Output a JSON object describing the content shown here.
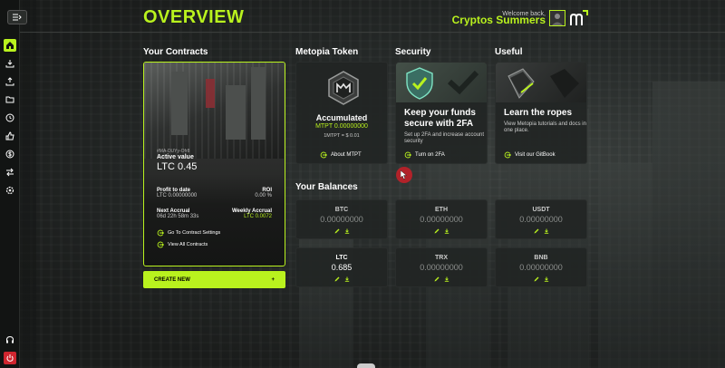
{
  "header": {
    "title": "OVERVIEW",
    "welcome": "Welcome back,",
    "username": "Cryptos Summers"
  },
  "sections": {
    "contracts": "Your Contracts",
    "token": "Metopia Token",
    "security": "Security",
    "useful": "Useful",
    "balances": "Your Balances"
  },
  "contract": {
    "id": "#MA-DUYy-Ofr8",
    "active_label": "Active value",
    "active_value": "LTC 0.45",
    "profit_label": "Profit to date",
    "profit_value": "LTC 0.00000000",
    "roi_label": "ROI",
    "roi_value": "0.00 %",
    "next_label": "Next Accrual",
    "next_value": "06d 22h 58m 33s",
    "weekly_label": "Weekly Accrual",
    "weekly_value": "LTC 0.0072",
    "link_settings": "Go To Contract Settings",
    "link_all": "View All Contracts"
  },
  "create_button": {
    "label": "CREATE NEW",
    "icon": "+"
  },
  "token": {
    "label": "Accumulated",
    "amount": "MTPT 0.00000000",
    "rate": "1MTPT = $ 0.01",
    "link": "About MTPT"
  },
  "security": {
    "title": "Keep your funds secure with 2FA",
    "desc": "Set up 2FA and increase account security",
    "link": "Turn on 2FA"
  },
  "useful": {
    "title": "Learn the ropes",
    "desc": "View Metopia tutorials and docs in one place.",
    "link": "Visit our GitBook"
  },
  "balances": [
    {
      "symbol": "BTC",
      "amount": "0.00000000",
      "active": false
    },
    {
      "symbol": "ETH",
      "amount": "0.00000000",
      "active": false
    },
    {
      "symbol": "USDT",
      "amount": "0.00000000",
      "active": false
    },
    {
      "symbol": "LTC",
      "amount": "0.685",
      "active": true
    },
    {
      "symbol": "TRX",
      "amount": "0.00000000",
      "active": false
    },
    {
      "symbol": "BNB",
      "amount": "0.00000000",
      "active": false
    }
  ],
  "colors": {
    "accent": "#b9f21e",
    "panel": "#222524",
    "logout": "#d0262f"
  },
  "sidebar_icons": [
    "home-icon",
    "download-icon",
    "upload-icon",
    "folder-icon",
    "clock-icon",
    "thumbs-up-icon",
    "dollar-icon",
    "transfer-icon",
    "settings-icon"
  ],
  "sidebar_bottom_icons": [
    "headset-icon",
    "power-icon"
  ]
}
